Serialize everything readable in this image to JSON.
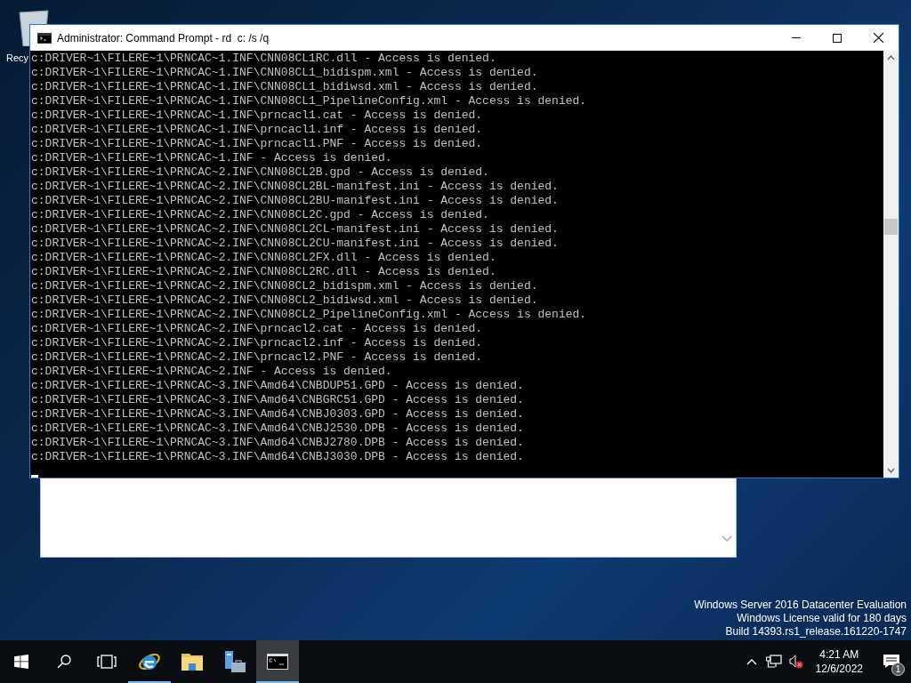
{
  "desktop": {
    "icons": [
      {
        "label": "Recy"
      }
    ]
  },
  "console": {
    "title": "Administrator: Command Prompt - rd  c: /s /q",
    "lines": [
      "c:DRIVER~1\\FILERE~1\\PRNCAC~1.INF\\CNN08CL1RC.dll - Access is denied.",
      "c:DRIVER~1\\FILERE~1\\PRNCAC~1.INF\\CNN08CL1_bidispm.xml - Access is denied.",
      "c:DRIVER~1\\FILERE~1\\PRNCAC~1.INF\\CNN08CL1_bidiwsd.xml - Access is denied.",
      "c:DRIVER~1\\FILERE~1\\PRNCAC~1.INF\\CNN08CL1_PipelineConfig.xml - Access is denied.",
      "c:DRIVER~1\\FILERE~1\\PRNCAC~1.INF\\prncacl1.cat - Access is denied.",
      "c:DRIVER~1\\FILERE~1\\PRNCAC~1.INF\\prncacl1.inf - Access is denied.",
      "c:DRIVER~1\\FILERE~1\\PRNCAC~1.INF\\prncacl1.PNF - Access is denied.",
      "c:DRIVER~1\\FILERE~1\\PRNCAC~1.INF - Access is denied.",
      "c:DRIVER~1\\FILERE~1\\PRNCAC~2.INF\\CNN08CL2B.gpd - Access is denied.",
      "c:DRIVER~1\\FILERE~1\\PRNCAC~2.INF\\CNN08CL2BL-manifest.ini - Access is denied.",
      "c:DRIVER~1\\FILERE~1\\PRNCAC~2.INF\\CNN08CL2BU-manifest.ini - Access is denied.",
      "c:DRIVER~1\\FILERE~1\\PRNCAC~2.INF\\CNN08CL2C.gpd - Access is denied.",
      "c:DRIVER~1\\FILERE~1\\PRNCAC~2.INF\\CNN08CL2CL-manifest.ini - Access is denied.",
      "c:DRIVER~1\\FILERE~1\\PRNCAC~2.INF\\CNN08CL2CU-manifest.ini - Access is denied.",
      "c:DRIVER~1\\FILERE~1\\PRNCAC~2.INF\\CNN08CL2FX.dll - Access is denied.",
      "c:DRIVER~1\\FILERE~1\\PRNCAC~2.INF\\CNN08CL2RC.dll - Access is denied.",
      "c:DRIVER~1\\FILERE~1\\PRNCAC~2.INF\\CNN08CL2_bidispm.xml - Access is denied.",
      "c:DRIVER~1\\FILERE~1\\PRNCAC~2.INF\\CNN08CL2_bidiwsd.xml - Access is denied.",
      "c:DRIVER~1\\FILERE~1\\PRNCAC~2.INF\\CNN08CL2_PipelineConfig.xml - Access is denied.",
      "c:DRIVER~1\\FILERE~1\\PRNCAC~2.INF\\prncacl2.cat - Access is denied.",
      "c:DRIVER~1\\FILERE~1\\PRNCAC~2.INF\\prncacl2.inf - Access is denied.",
      "c:DRIVER~1\\FILERE~1\\PRNCAC~2.INF\\prncacl2.PNF - Access is denied.",
      "c:DRIVER~1\\FILERE~1\\PRNCAC~2.INF - Access is denied.",
      "c:DRIVER~1\\FILERE~1\\PRNCAC~3.INF\\Amd64\\CNBDUP51.GPD - Access is denied.",
      "c:DRIVER~1\\FILERE~1\\PRNCAC~3.INF\\Amd64\\CNBGRC51.GPD - Access is denied.",
      "c:DRIVER~1\\FILERE~1\\PRNCAC~3.INF\\Amd64\\CNBJ0303.GPD - Access is denied.",
      "c:DRIVER~1\\FILERE~1\\PRNCAC~3.INF\\Amd64\\CNBJ2530.DPB - Access is denied.",
      "c:DRIVER~1\\FILERE~1\\PRNCAC~3.INF\\Amd64\\CNBJ2780.DPB - Access is denied.",
      "c:DRIVER~1\\FILERE~1\\PRNCAC~3.INF\\Amd64\\CNBJ3030.DPB - Access is denied."
    ]
  },
  "watermark": [
    "Windows Server 2016 Datacenter Evaluation",
    "Windows License valid for 180 days",
    "Build 14393.rs1_release.161220-1747"
  ],
  "taskbar": {
    "apps": [
      {
        "kind": "start",
        "running": false,
        "selected": false
      },
      {
        "kind": "search",
        "running": false,
        "selected": false
      },
      {
        "kind": "taskview",
        "running": false,
        "selected": false
      },
      {
        "kind": "browser",
        "running": true,
        "selected": false
      },
      {
        "kind": "folder",
        "running": false,
        "selected": false
      },
      {
        "kind": "server",
        "running": false,
        "selected": false
      },
      {
        "kind": "console",
        "running": true,
        "selected": true
      }
    ],
    "time": "4:21 AM",
    "date": "12/6/2022",
    "notifications": "1"
  }
}
